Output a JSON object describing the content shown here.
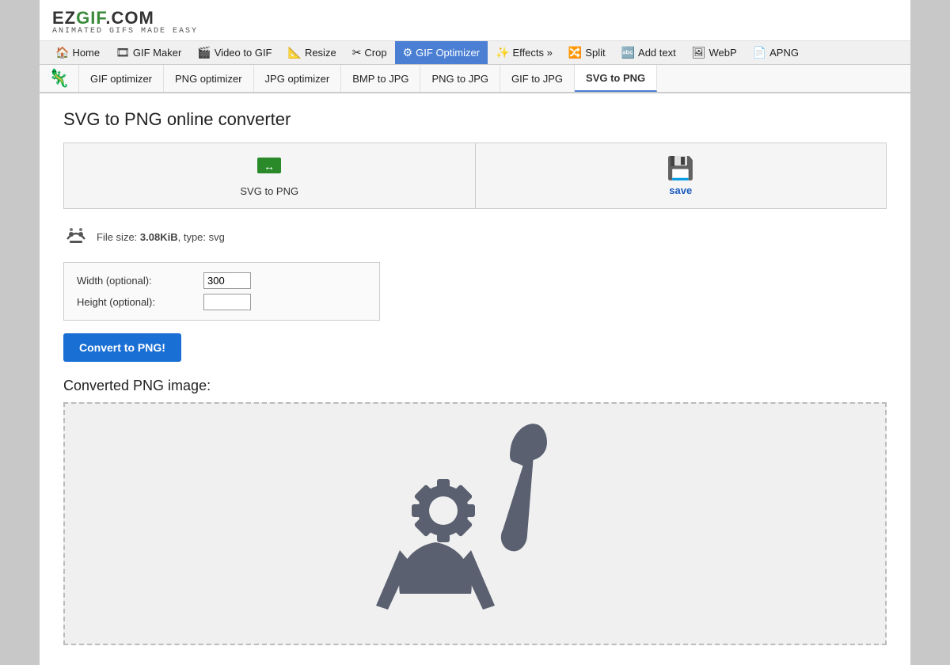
{
  "logo": {
    "main": "EZGIF.COM",
    "sub": "ANIMATED GIFS MADE EASY"
  },
  "nav": {
    "items": [
      {
        "label": "Home",
        "icon": "🏠",
        "active": false,
        "name": "home"
      },
      {
        "label": "GIF Maker",
        "icon": "🎞️",
        "active": false,
        "name": "gif-maker"
      },
      {
        "label": "Video to GIF",
        "icon": "🎬",
        "active": false,
        "name": "video-to-gif"
      },
      {
        "label": "Resize",
        "icon": "📐",
        "active": false,
        "name": "resize"
      },
      {
        "label": "Crop",
        "icon": "✂️",
        "active": false,
        "name": "crop"
      },
      {
        "label": "GIF Optimizer",
        "icon": "⚙️",
        "active": true,
        "name": "gif-optimizer"
      },
      {
        "label": "Effects »",
        "icon": "✨",
        "active": false,
        "name": "effects"
      },
      {
        "label": "Split",
        "icon": "🔀",
        "active": false,
        "name": "split"
      },
      {
        "label": "Add text",
        "icon": "🔤",
        "active": false,
        "name": "add-text"
      },
      {
        "label": "WebP",
        "icon": "🖼️",
        "active": false,
        "name": "webp"
      },
      {
        "label": "APNG",
        "icon": "📄",
        "active": false,
        "name": "apng"
      }
    ]
  },
  "sub_nav": {
    "items": [
      {
        "label": "GIF optimizer",
        "active": false,
        "name": "gif-optimizer-tab"
      },
      {
        "label": "PNG optimizer",
        "active": false,
        "name": "png-optimizer-tab"
      },
      {
        "label": "JPG optimizer",
        "active": false,
        "name": "jpg-optimizer-tab"
      },
      {
        "label": "BMP to JPG",
        "active": false,
        "name": "bmp-to-jpg-tab"
      },
      {
        "label": "PNG to JPG",
        "active": false,
        "name": "png-to-jpg-tab"
      },
      {
        "label": "GIF to JPG",
        "active": false,
        "name": "gif-to-jpg-tab"
      },
      {
        "label": "SVG to PNG",
        "active": true,
        "name": "svg-to-png-tab"
      }
    ]
  },
  "page": {
    "title": "SVG to PNG online converter"
  },
  "actions": {
    "upload_label": "SVG to PNG",
    "upload_icon": "↔",
    "save_label": "save",
    "save_icon": "💾"
  },
  "file_info": {
    "size": "3.08KiB",
    "type": "svg",
    "prefix": "File size: ",
    "suffix": ", type: svg"
  },
  "options": {
    "width_label": "Width (optional):",
    "width_value": "300",
    "height_label": "Height (optional):",
    "height_value": ""
  },
  "convert_button": "Convert to PNG!",
  "result": {
    "title": "Converted PNG image:"
  }
}
